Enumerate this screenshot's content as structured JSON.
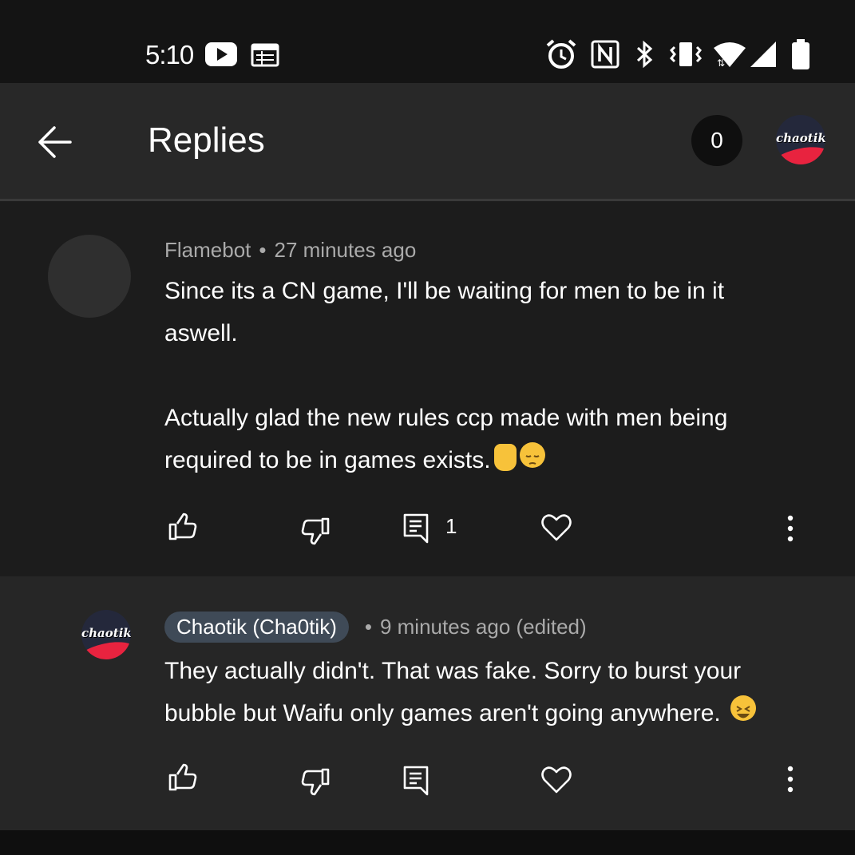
{
  "status_bar": {
    "time": "5:10",
    "left_icons": [
      "youtube-icon",
      "calendar-icon"
    ],
    "right_icons": [
      "alarm-icon",
      "nfc-icon",
      "bluetooth-icon",
      "vibrate-icon",
      "wifi-icon",
      "signal-icon",
      "battery-icon"
    ]
  },
  "app_bar": {
    "title": "Replies",
    "counter": "0",
    "avatar_text": "chaotik"
  },
  "parent_comment": {
    "author": "Flamebot",
    "separator": "•",
    "time": "27 minutes ago",
    "text": "Since its a CN game, I'll be waiting for men to be in it aswell.\n\nActually glad the new rules ccp made with men being required to be in games exists.",
    "emojis": [
      "raised-hand-emoji",
      "pensive-face-emoji"
    ],
    "reply_count": "1"
  },
  "reply_comment": {
    "author": "Chaotik (Cha0tik)",
    "separator": "•",
    "time": "9 minutes ago (edited)",
    "avatar_text": "chaotik",
    "text": "They actually didn't. That was fake. Sorry to burst your bubble but Waifu only games aren't going anywhere.",
    "emojis": [
      "grinning-squinting-face-emoji"
    ]
  },
  "colors": {
    "background": "#1c1c1c",
    "app_bar": "#282828",
    "reply_background": "#262626",
    "author_chip": "#3f4a57",
    "logo_red": "#e8233f"
  }
}
